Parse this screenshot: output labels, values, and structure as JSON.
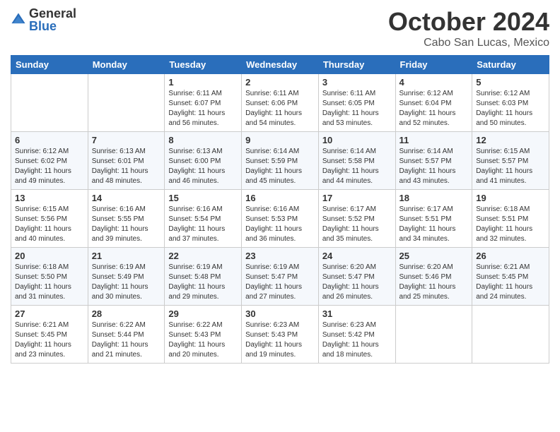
{
  "logo": {
    "general": "General",
    "blue": "Blue"
  },
  "title": "October 2024",
  "location": "Cabo San Lucas, Mexico",
  "days_of_week": [
    "Sunday",
    "Monday",
    "Tuesday",
    "Wednesday",
    "Thursday",
    "Friday",
    "Saturday"
  ],
  "weeks": [
    [
      {
        "day": "",
        "info": ""
      },
      {
        "day": "",
        "info": ""
      },
      {
        "day": "1",
        "info": "Sunrise: 6:11 AM\nSunset: 6:07 PM\nDaylight: 11 hours and 56 minutes."
      },
      {
        "day": "2",
        "info": "Sunrise: 6:11 AM\nSunset: 6:06 PM\nDaylight: 11 hours and 54 minutes."
      },
      {
        "day": "3",
        "info": "Sunrise: 6:11 AM\nSunset: 6:05 PM\nDaylight: 11 hours and 53 minutes."
      },
      {
        "day": "4",
        "info": "Sunrise: 6:12 AM\nSunset: 6:04 PM\nDaylight: 11 hours and 52 minutes."
      },
      {
        "day": "5",
        "info": "Sunrise: 6:12 AM\nSunset: 6:03 PM\nDaylight: 11 hours and 50 minutes."
      }
    ],
    [
      {
        "day": "6",
        "info": "Sunrise: 6:12 AM\nSunset: 6:02 PM\nDaylight: 11 hours and 49 minutes."
      },
      {
        "day": "7",
        "info": "Sunrise: 6:13 AM\nSunset: 6:01 PM\nDaylight: 11 hours and 48 minutes."
      },
      {
        "day": "8",
        "info": "Sunrise: 6:13 AM\nSunset: 6:00 PM\nDaylight: 11 hours and 46 minutes."
      },
      {
        "day": "9",
        "info": "Sunrise: 6:14 AM\nSunset: 5:59 PM\nDaylight: 11 hours and 45 minutes."
      },
      {
        "day": "10",
        "info": "Sunrise: 6:14 AM\nSunset: 5:58 PM\nDaylight: 11 hours and 44 minutes."
      },
      {
        "day": "11",
        "info": "Sunrise: 6:14 AM\nSunset: 5:57 PM\nDaylight: 11 hours and 43 minutes."
      },
      {
        "day": "12",
        "info": "Sunrise: 6:15 AM\nSunset: 5:57 PM\nDaylight: 11 hours and 41 minutes."
      }
    ],
    [
      {
        "day": "13",
        "info": "Sunrise: 6:15 AM\nSunset: 5:56 PM\nDaylight: 11 hours and 40 minutes."
      },
      {
        "day": "14",
        "info": "Sunrise: 6:16 AM\nSunset: 5:55 PM\nDaylight: 11 hours and 39 minutes."
      },
      {
        "day": "15",
        "info": "Sunrise: 6:16 AM\nSunset: 5:54 PM\nDaylight: 11 hours and 37 minutes."
      },
      {
        "day": "16",
        "info": "Sunrise: 6:16 AM\nSunset: 5:53 PM\nDaylight: 11 hours and 36 minutes."
      },
      {
        "day": "17",
        "info": "Sunrise: 6:17 AM\nSunset: 5:52 PM\nDaylight: 11 hours and 35 minutes."
      },
      {
        "day": "18",
        "info": "Sunrise: 6:17 AM\nSunset: 5:51 PM\nDaylight: 11 hours and 34 minutes."
      },
      {
        "day": "19",
        "info": "Sunrise: 6:18 AM\nSunset: 5:51 PM\nDaylight: 11 hours and 32 minutes."
      }
    ],
    [
      {
        "day": "20",
        "info": "Sunrise: 6:18 AM\nSunset: 5:50 PM\nDaylight: 11 hours and 31 minutes."
      },
      {
        "day": "21",
        "info": "Sunrise: 6:19 AM\nSunset: 5:49 PM\nDaylight: 11 hours and 30 minutes."
      },
      {
        "day": "22",
        "info": "Sunrise: 6:19 AM\nSunset: 5:48 PM\nDaylight: 11 hours and 29 minutes."
      },
      {
        "day": "23",
        "info": "Sunrise: 6:19 AM\nSunset: 5:47 PM\nDaylight: 11 hours and 27 minutes."
      },
      {
        "day": "24",
        "info": "Sunrise: 6:20 AM\nSunset: 5:47 PM\nDaylight: 11 hours and 26 minutes."
      },
      {
        "day": "25",
        "info": "Sunrise: 6:20 AM\nSunset: 5:46 PM\nDaylight: 11 hours and 25 minutes."
      },
      {
        "day": "26",
        "info": "Sunrise: 6:21 AM\nSunset: 5:45 PM\nDaylight: 11 hours and 24 minutes."
      }
    ],
    [
      {
        "day": "27",
        "info": "Sunrise: 6:21 AM\nSunset: 5:45 PM\nDaylight: 11 hours and 23 minutes."
      },
      {
        "day": "28",
        "info": "Sunrise: 6:22 AM\nSunset: 5:44 PM\nDaylight: 11 hours and 21 minutes."
      },
      {
        "day": "29",
        "info": "Sunrise: 6:22 AM\nSunset: 5:43 PM\nDaylight: 11 hours and 20 minutes."
      },
      {
        "day": "30",
        "info": "Sunrise: 6:23 AM\nSunset: 5:43 PM\nDaylight: 11 hours and 19 minutes."
      },
      {
        "day": "31",
        "info": "Sunrise: 6:23 AM\nSunset: 5:42 PM\nDaylight: 11 hours and 18 minutes."
      },
      {
        "day": "",
        "info": ""
      },
      {
        "day": "",
        "info": ""
      }
    ]
  ]
}
